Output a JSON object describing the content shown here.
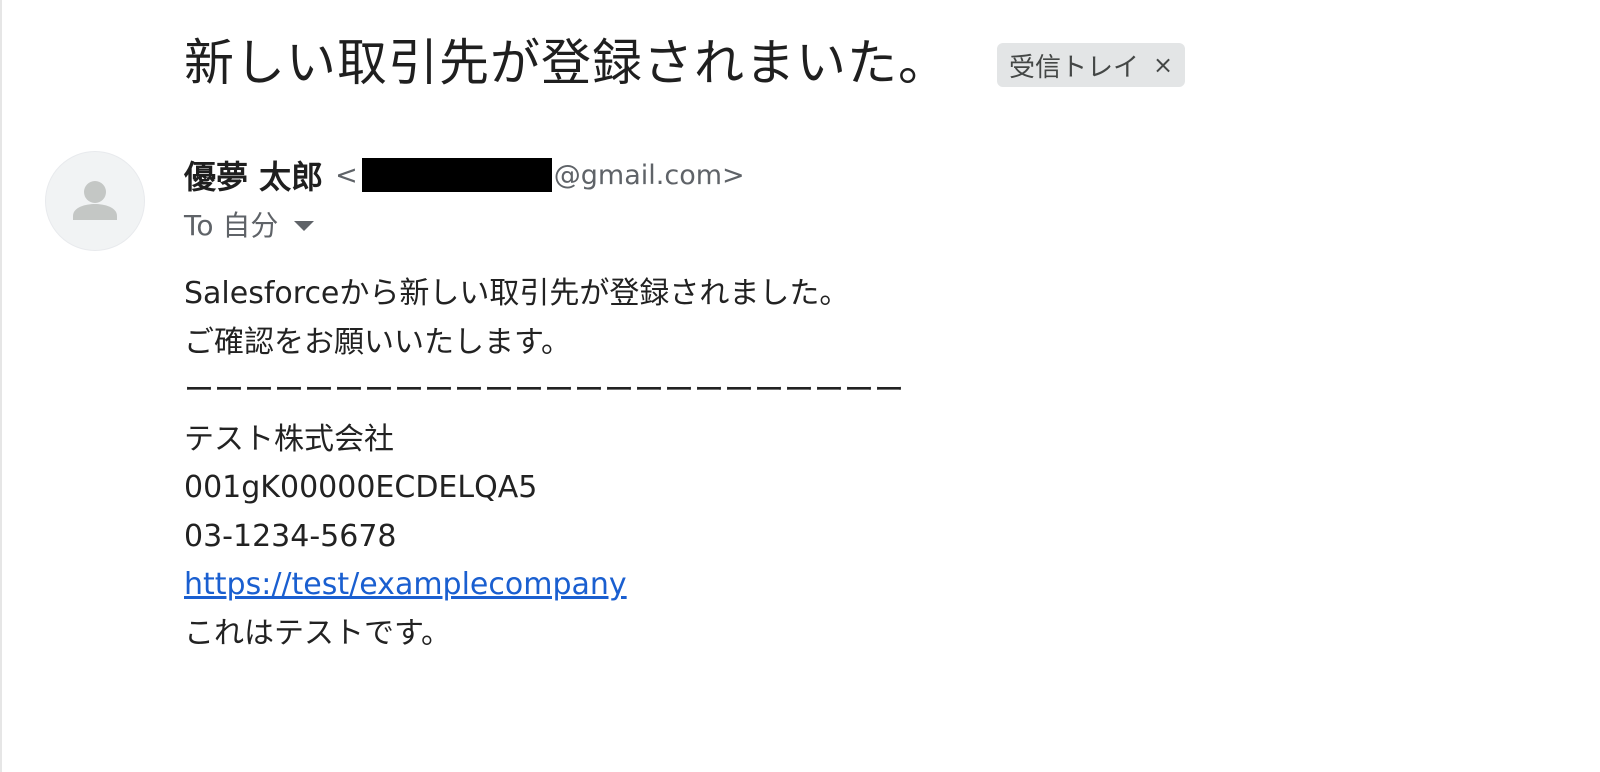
{
  "subject": "新しい取引先が登録されまいた。",
  "label_chip": {
    "label": "受信トレイ",
    "close": "×"
  },
  "sender": {
    "name": "優夢 太郎",
    "email_open": "<",
    "email_domain": "@gmail.com>"
  },
  "recipient": {
    "label": "To 自分"
  },
  "body": {
    "line1": "Salesforceから新しい取引先が登録されました。",
    "line2": "ご確認をお願いいたします。",
    "separator": "ーーーーーーーーーーーーーーーーーーーーーーーー",
    "company": "テスト株式会社",
    "record_id": "001gK00000ECDELQA5",
    "phone": "03-1234-5678",
    "url": "https://test/examplecompany",
    "closing": "これはテストです。"
  },
  "colors": {
    "link": "#1a5fd0",
    "chip_bg": "#e3e5e6",
    "muted_text": "#5f6368"
  },
  "icons": {
    "avatar": "person-avatar-icon",
    "to_toggle": "caret-down-icon",
    "chip_close": "close-icon"
  }
}
